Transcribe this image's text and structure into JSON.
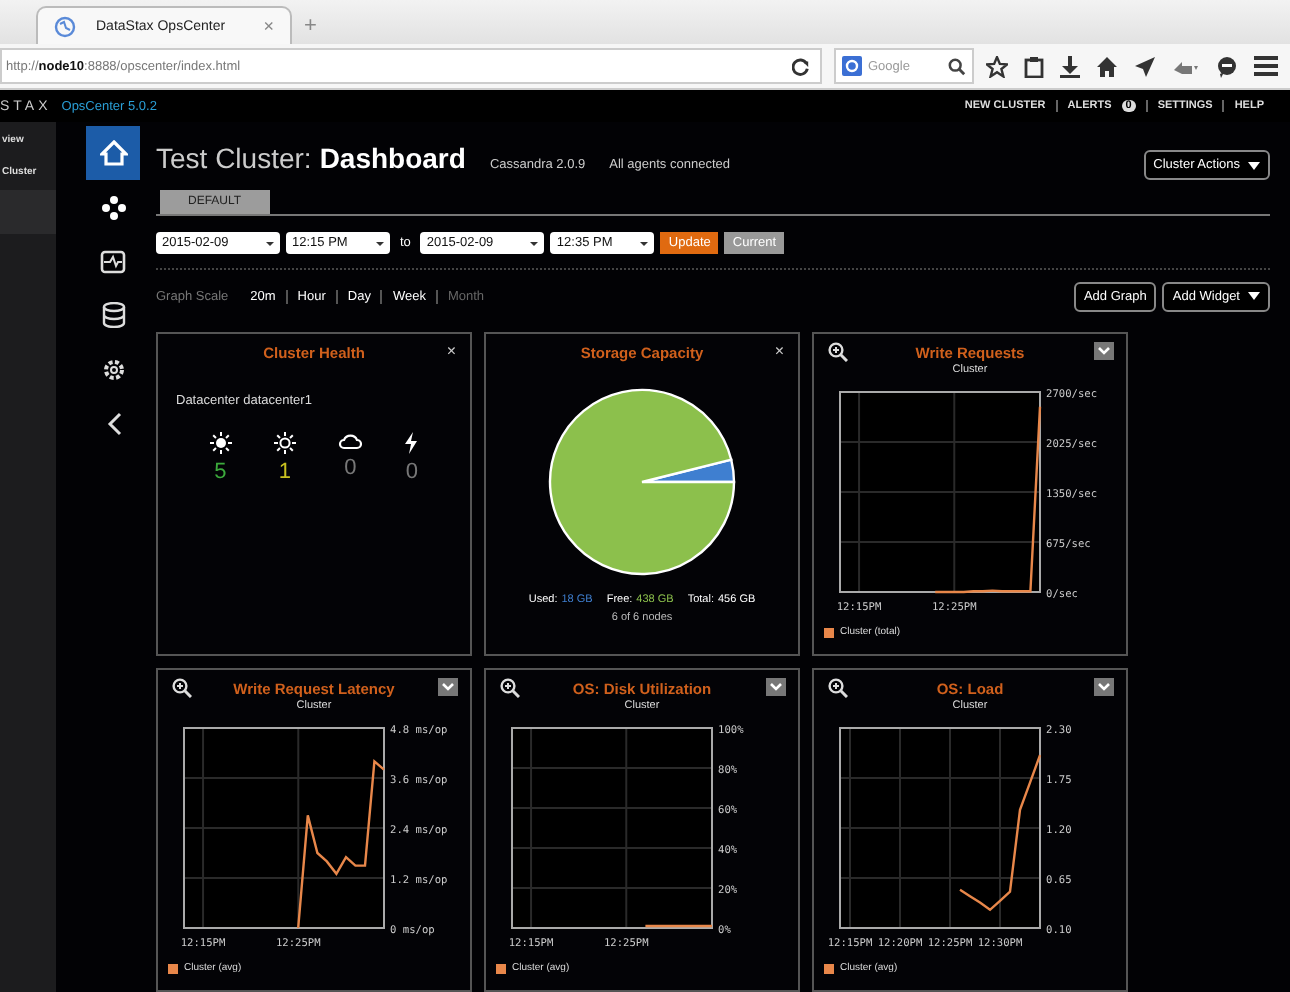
{
  "browser": {
    "tab_title": "DataStax OpsCenter",
    "tab_close": "×",
    "new_tab": "+",
    "url": "http://**node10**:8888/opscenter/index.html",
    "search_placeholder": "Google"
  },
  "topbar": {
    "logo": "STAX",
    "product": "OpsCenter 5.0.2",
    "links": [
      {
        "label": "NEW CLUSTER"
      },
      {
        "label": "ALERTS",
        "badge": "0"
      },
      {
        "label": "SETTINGS"
      },
      {
        "label": "HELP"
      }
    ]
  },
  "side_nav": [
    {
      "label": "view"
    },
    {
      "label": "Cluster"
    }
  ],
  "icon_rail": [
    {
      "kind": "home",
      "selected": true
    },
    {
      "kind": "nodes",
      "selected": false
    },
    {
      "kind": "activity",
      "selected": false
    },
    {
      "kind": "data",
      "selected": false
    },
    {
      "kind": "settings",
      "selected": false
    },
    {
      "kind": "collapse",
      "selected": false
    }
  ],
  "header": {
    "cluster": "Test Cluster:",
    "page": "Dashboard",
    "version": "Cassandra 2.0.9",
    "status": "All agents connected",
    "actions": "Cluster Actions"
  },
  "tabs": [
    {
      "label": "DEFAULT",
      "selected": true
    }
  ],
  "range": {
    "from_date": "2015-02-09",
    "from_time": "12:15 PM",
    "to": "to",
    "to_date": "2015-02-09",
    "to_time": "12:35 PM",
    "update": "Update",
    "current": "Current"
  },
  "graph_scale": {
    "label": "Graph Scale",
    "options": [
      {
        "label": "20m",
        "disabled": false
      },
      {
        "label": "Hour",
        "disabled": false
      },
      {
        "label": "Day",
        "disabled": false
      },
      {
        "label": "Week",
        "disabled": false
      },
      {
        "label": "Month",
        "disabled": true
      }
    ]
  },
  "toolbar": {
    "add_graph": "Add Graph",
    "add_widget": "Add Widget"
  },
  "widgets": [
    {
      "kind": "health",
      "title": "Cluster Health",
      "close": "×",
      "datacenter": "Datacenter datacenter1",
      "counts": [
        {
          "kind": "up",
          "value": "5",
          "color": "#3caa3c"
        },
        {
          "kind": "warn",
          "value": "1",
          "color": "#c8c020"
        },
        {
          "kind": "down",
          "value": "0",
          "color": "#777777"
        },
        {
          "kind": "error",
          "value": "0",
          "color": "#777777"
        }
      ]
    },
    {
      "kind": "pie",
      "title": "Storage Capacity",
      "close": "×",
      "legend": [
        {
          "label": "Used:",
          "value": "18 GB",
          "color": "#3f7fd0"
        },
        {
          "label": "Free:",
          "value": "438 GB",
          "color": "#8cc04c"
        }
      ],
      "total": {
        "label": "Total:",
        "value": "456 GB"
      },
      "nodes": "6 of 6 nodes",
      "chart_data": {
        "type": "pie",
        "values": [
          3.9,
          96.1
        ]
      }
    },
    {
      "kind": "line",
      "title": "Write Requests",
      "subtitle": "Cluster",
      "chart_data": {
        "type": "line",
        "grid": true,
        "categories": [
          null,
          null,
          "12:15PM",
          null,
          null,
          null,
          null,
          null,
          null,
          null,
          null,
          null,
          "12:25PM",
          null,
          null,
          null,
          null,
          null,
          null,
          null,
          null,
          null
        ],
        "yticks": [
          {
            "value": 0,
            "label": "0/sec"
          },
          {
            "value": 675,
            "label": "675/sec"
          },
          {
            "value": 1350,
            "label": "1350/sec"
          },
          {
            "value": 2025,
            "label": "2025/sec"
          },
          {
            "value": 2700,
            "label": "2700/sec"
          }
        ],
        "ylim": [
          0,
          2700
        ],
        "series": [
          {
            "name": "Cluster (total)",
            "color": "#e8874a",
            "values": [
              null,
              null,
              null,
              null,
              null,
              null,
              null,
              null,
              null,
              null,
              0,
              0,
              0,
              0,
              10,
              10,
              20,
              10,
              10,
              10,
              10,
              2500
            ]
          }
        ]
      }
    },
    {
      "kind": "line",
      "title": "Write Request Latency",
      "subtitle": "Cluster",
      "chart_data": {
        "type": "line",
        "grid": true,
        "categories": [
          null,
          null,
          "12:15PM",
          null,
          null,
          null,
          null,
          null,
          null,
          null,
          null,
          null,
          "12:25PM",
          null,
          null,
          null,
          null,
          null,
          null,
          null,
          null,
          null
        ],
        "yticks": [
          {
            "value": 0,
            "label": "0 ms/op"
          },
          {
            "value": 1.2,
            "label": "1.2 ms/op"
          },
          {
            "value": 2.4,
            "label": "2.4 ms/op"
          },
          {
            "value": 3.6,
            "label": "3.6 ms/op"
          },
          {
            "value": 4.8,
            "label": "4.8 ms/op"
          }
        ],
        "ylim": [
          0,
          4.8
        ],
        "series": [
          {
            "name": "Cluster (avg)",
            "color": "#e8874a",
            "values": [
              null,
              null,
              null,
              null,
              null,
              null,
              null,
              null,
              null,
              null,
              null,
              null,
              0,
              2.7,
              1.8,
              1.6,
              1.3,
              1.7,
              1.5,
              1.5,
              4.0,
              3.8
            ]
          }
        ]
      }
    },
    {
      "kind": "line",
      "title": "OS: Disk Utilization",
      "subtitle": "Cluster",
      "chart_data": {
        "type": "line",
        "grid": true,
        "categories": [
          null,
          null,
          "12:15PM",
          null,
          null,
          null,
          null,
          null,
          null,
          null,
          null,
          null,
          "12:25PM",
          null,
          null,
          null,
          null,
          null,
          null,
          null,
          null,
          null
        ],
        "yticks": [
          {
            "value": 0,
            "label": "0%"
          },
          {
            "value": 20,
            "label": "20%"
          },
          {
            "value": 40,
            "label": "40%"
          },
          {
            "value": 60,
            "label": "60%"
          },
          {
            "value": 80,
            "label": "80%"
          },
          {
            "value": 100,
            "label": "100%"
          }
        ],
        "ylim": [
          0,
          100
        ],
        "series": [
          {
            "name": "Cluster (avg)",
            "color": "#e8874a",
            "values": [
              null,
              null,
              null,
              null,
              null,
              null,
              null,
              null,
              null,
              null,
              null,
              null,
              null,
              null,
              1,
              1,
              1,
              1,
              1,
              1,
              1,
              1
            ]
          }
        ]
      }
    },
    {
      "kind": "line",
      "title": "OS: Load",
      "subtitle": "Cluster",
      "chart_data": {
        "type": "line",
        "grid": true,
        "categories": [
          null,
          "12:15PM",
          null,
          null,
          null,
          null,
          "12:20PM",
          null,
          null,
          null,
          null,
          "12:25PM",
          null,
          null,
          null,
          null,
          "12:30PM",
          null,
          null,
          null,
          null
        ],
        "yticks": [
          {
            "value": 0.1,
            "label": "0.10"
          },
          {
            "value": 0.65,
            "label": "0.65"
          },
          {
            "value": 1.2,
            "label": "1.20"
          },
          {
            "value": 1.75,
            "label": "1.75"
          },
          {
            "value": 2.3,
            "label": "2.30"
          }
        ],
        "ylim": [
          0.1,
          2.3
        ],
        "series": [
          {
            "name": "Cluster (avg)",
            "color": "#e8874a",
            "values": [
              null,
              null,
              null,
              null,
              null,
              null,
              null,
              null,
              null,
              null,
              null,
              null,
              0.52,
              0.45,
              0.38,
              0.3,
              0.4,
              0.5,
              1.4,
              1.7,
              2.0
            ]
          }
        ]
      }
    }
  ]
}
